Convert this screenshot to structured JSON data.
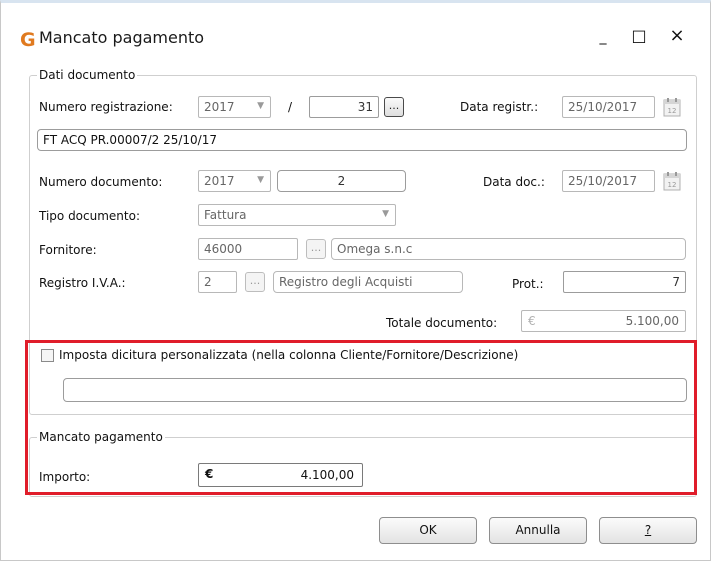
{
  "window": {
    "logo": "G",
    "title": "Mancato pagamento",
    "minimize": "_",
    "maximize": "□",
    "close": "×"
  },
  "dati_documento": {
    "legend": "Dati documento",
    "numero_registrazione_label": "Numero registrazione:",
    "anno_reg": "2017",
    "slash": "/",
    "numero_reg": "31",
    "ellipsis": "...",
    "data_registr_label": "Data registr.:",
    "data_registr": "25/10/2017",
    "descrizione": "FT ACQ PR.00007/2 25/10/17",
    "numero_documento_label": "Numero documento:",
    "anno_doc": "2017",
    "numero_doc": "2",
    "data_doc_label": "Data doc.:",
    "data_doc": "25/10/2017",
    "tipo_documento_label": "Tipo documento:",
    "tipo_documento": "Fattura",
    "fornitore_label": "Fornitore:",
    "fornitore_code": "46000",
    "fornitore_name": "Omega s.n.c",
    "registro_iva_label": "Registro I.V.A.:",
    "registro_code": "2",
    "registro_name": "Registro degli Acquisti",
    "prot_label": "Prot.:",
    "prot": "7",
    "totale_label": "Totale documento:",
    "currency": "€",
    "totale": "5.100,00"
  },
  "dicitura": {
    "checkbox_label": "Imposta dicitura personalizzata (nella colonna Cliente/Fornitore/Descrizione)",
    "checked": false,
    "value": ""
  },
  "mancato": {
    "legend": "Mancato pagamento",
    "importo_label": "Importo:",
    "currency": "€",
    "importo": "4.100,00"
  },
  "buttons": {
    "ok": "OK",
    "annulla": "Annulla",
    "help": "?"
  },
  "colors": {
    "highlight": "#e01d2a",
    "logo": "#e07a1f"
  }
}
